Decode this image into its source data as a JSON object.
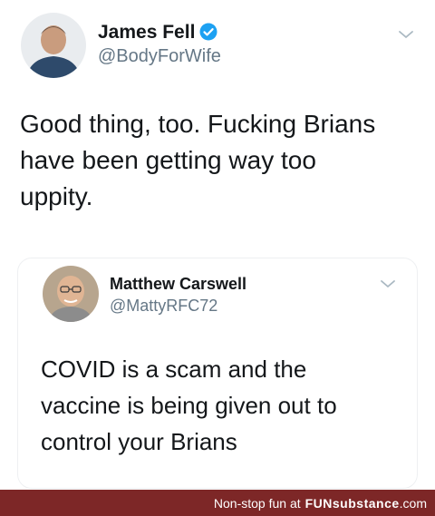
{
  "main_tweet": {
    "author_name": "James Fell",
    "handle": "@BodyForWife",
    "verified": true,
    "text_lines": [
      "Good thing, too. Fucking Brians",
      "have been getting way too",
      "uppity."
    ]
  },
  "quoted_tweet": {
    "author_name": "Matthew Carswell",
    "handle": "@MattyRFC72",
    "text_lines": [
      "COVID is a scam and the",
      "vaccine is being given out to",
      "control your Brians"
    ]
  },
  "footer": {
    "tagline": "Non-stop fun at",
    "brand": "FUNsubstance",
    "domain_suffix": ".com"
  },
  "colors": {
    "verified_badge": "#1da1f2",
    "handle_text": "#657786",
    "footer_bg": "#7d2727"
  },
  "icons": {
    "verified": "verified-badge-icon",
    "menu": "chevron-down-icon"
  }
}
